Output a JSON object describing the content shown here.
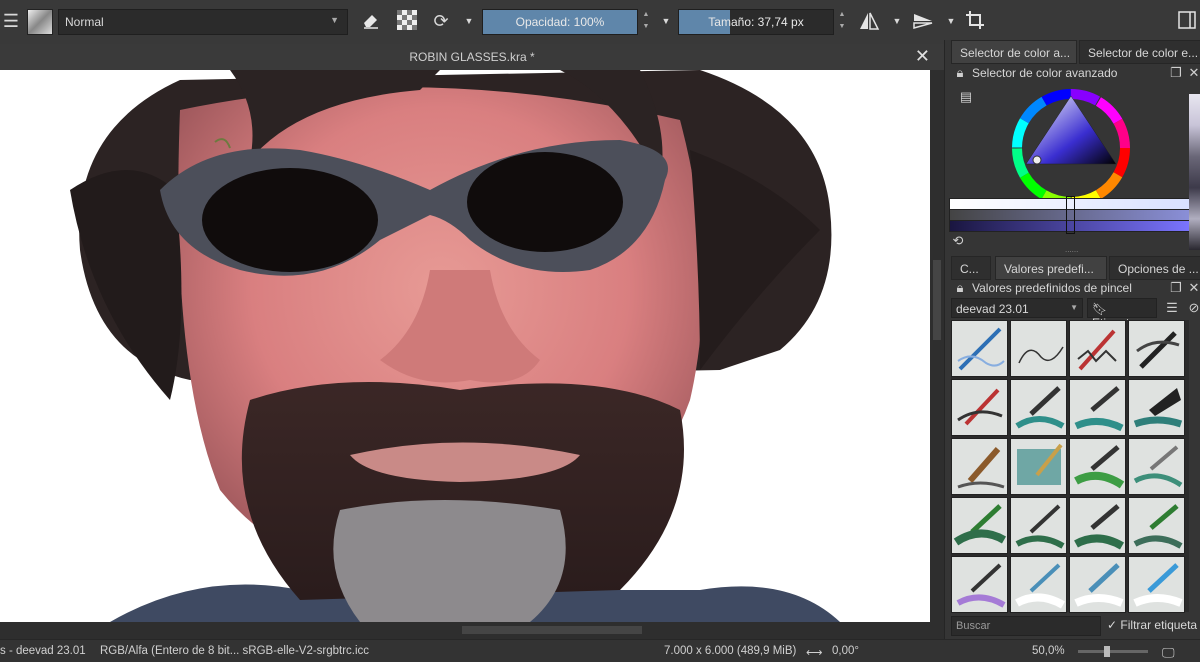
{
  "toolbar": {
    "blend_mode": "Normal",
    "opacity_label": "Opacidad: 100%",
    "opacity_value": 1.0,
    "size_label": "Tamaño: 37,74 px",
    "size_fill_fraction": 0.33
  },
  "document": {
    "title": "ROBIN GLASSES.kra *"
  },
  "docker_top": {
    "tabs": [
      "Selector de color a...",
      "Selector de color e..."
    ],
    "panel_title": "Selector de color avanzado"
  },
  "docker_bottom": {
    "tabs": [
      "C...",
      "Valores predefi...",
      "Opciones de ..."
    ],
    "panel_title": "Valores predefinidos de pincel",
    "preset_set": "deevad 23.01",
    "tag_label": "Etiqueta",
    "search_placeholder": "Buscar",
    "filter_label": "Filtrar etiqueta"
  },
  "status": {
    "brush": "s - deevad 23.01",
    "color_space": "RGB/Alfa (Entero de 8 bit...  sRGB-elle-V2-srgbtrc.icc",
    "dimensions": "7.000 x 6.000 (489,9 MiB)",
    "rotation": "0,00°",
    "zoom": "50,0%"
  },
  "colors": {
    "accent": "#5f86aa",
    "panel": "#353535",
    "toolbar": "#393939"
  }
}
